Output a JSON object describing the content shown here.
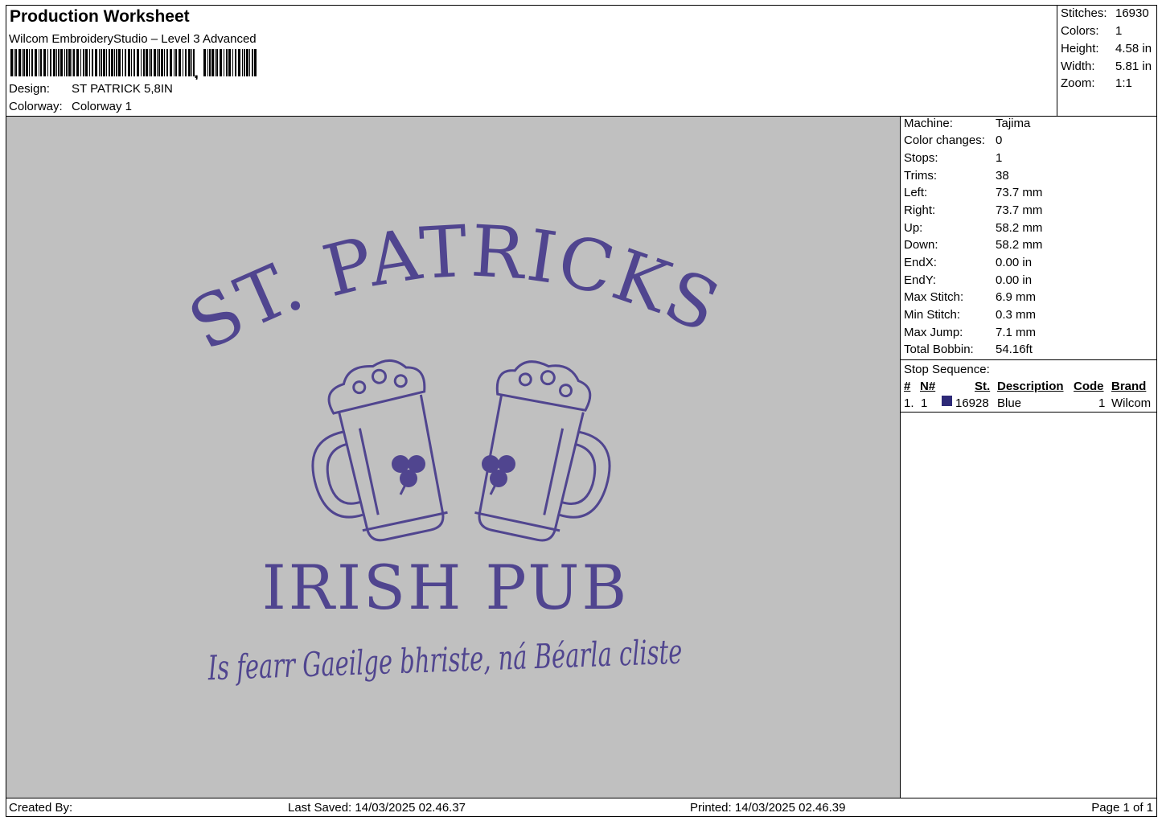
{
  "header": {
    "title": "Production Worksheet",
    "subtitle": "Wilcom EmbroideryStudio – Level 3 Advanced",
    "barcode_suffix": ",",
    "design_label": "Design:",
    "design_value": "ST PATRICK 5,8IN",
    "colorway_label": "Colorway:",
    "colorway_value": "Colorway 1"
  },
  "summary": [
    {
      "label": "Stitches:",
      "value": "16930"
    },
    {
      "label": "Colors:",
      "value": "1"
    },
    {
      "label": "Height:",
      "value": "4.58 in"
    },
    {
      "label": "Width:",
      "value": "5.81 in"
    },
    {
      "label": "Zoom:",
      "value": "1:1"
    }
  ],
  "machine_info": [
    {
      "label": "Machine:",
      "value": "Tajima"
    },
    {
      "label": "Color changes:",
      "value": "0"
    },
    {
      "label": "Stops:",
      "value": "1"
    },
    {
      "label": "Trims:",
      "value": "38"
    },
    {
      "label": "Left:",
      "value": "73.7 mm"
    },
    {
      "label": "Right:",
      "value": "73.7 mm"
    },
    {
      "label": "Up:",
      "value": "58.2 mm"
    },
    {
      "label": "Down:",
      "value": "58.2 mm"
    },
    {
      "label": "EndX:",
      "value": "0.00 in"
    },
    {
      "label": "EndY:",
      "value": "0.00 in"
    },
    {
      "label": "Max Stitch:",
      "value": "6.9 mm"
    },
    {
      "label": "Min Stitch:",
      "value": "0.3 mm"
    },
    {
      "label": "Max Jump:",
      "value": "7.1 mm"
    },
    {
      "label": "Total Bobbin:",
      "value": "54.16ft"
    }
  ],
  "stop_sequence": {
    "title": "Stop Sequence:",
    "columns": {
      "num": "#",
      "needle": "N#",
      "stitches": "St.",
      "description": "Description",
      "code": "Code",
      "brand": "Brand"
    },
    "rows": [
      {
        "num": "1.",
        "needle": "1",
        "stitches": "16928",
        "description": "Blue",
        "code": "1",
        "brand": "Wilcom",
        "color": "#2e2a78"
      }
    ]
  },
  "design": {
    "arc_text": "ST. PATRICKS",
    "main_text": "IRISH PUB",
    "script_text": "Is fearr Gaeilge bhriste, ná Béarla cliste",
    "thread_color": "#50458f",
    "background_color": "#c0c0c0"
  },
  "footer": {
    "created_by": "Created By:",
    "last_saved": "Last Saved: 14/03/2025 02.46.37",
    "printed": "Printed: 14/03/2025 02.46.39",
    "page": "Page 1 of 1"
  }
}
